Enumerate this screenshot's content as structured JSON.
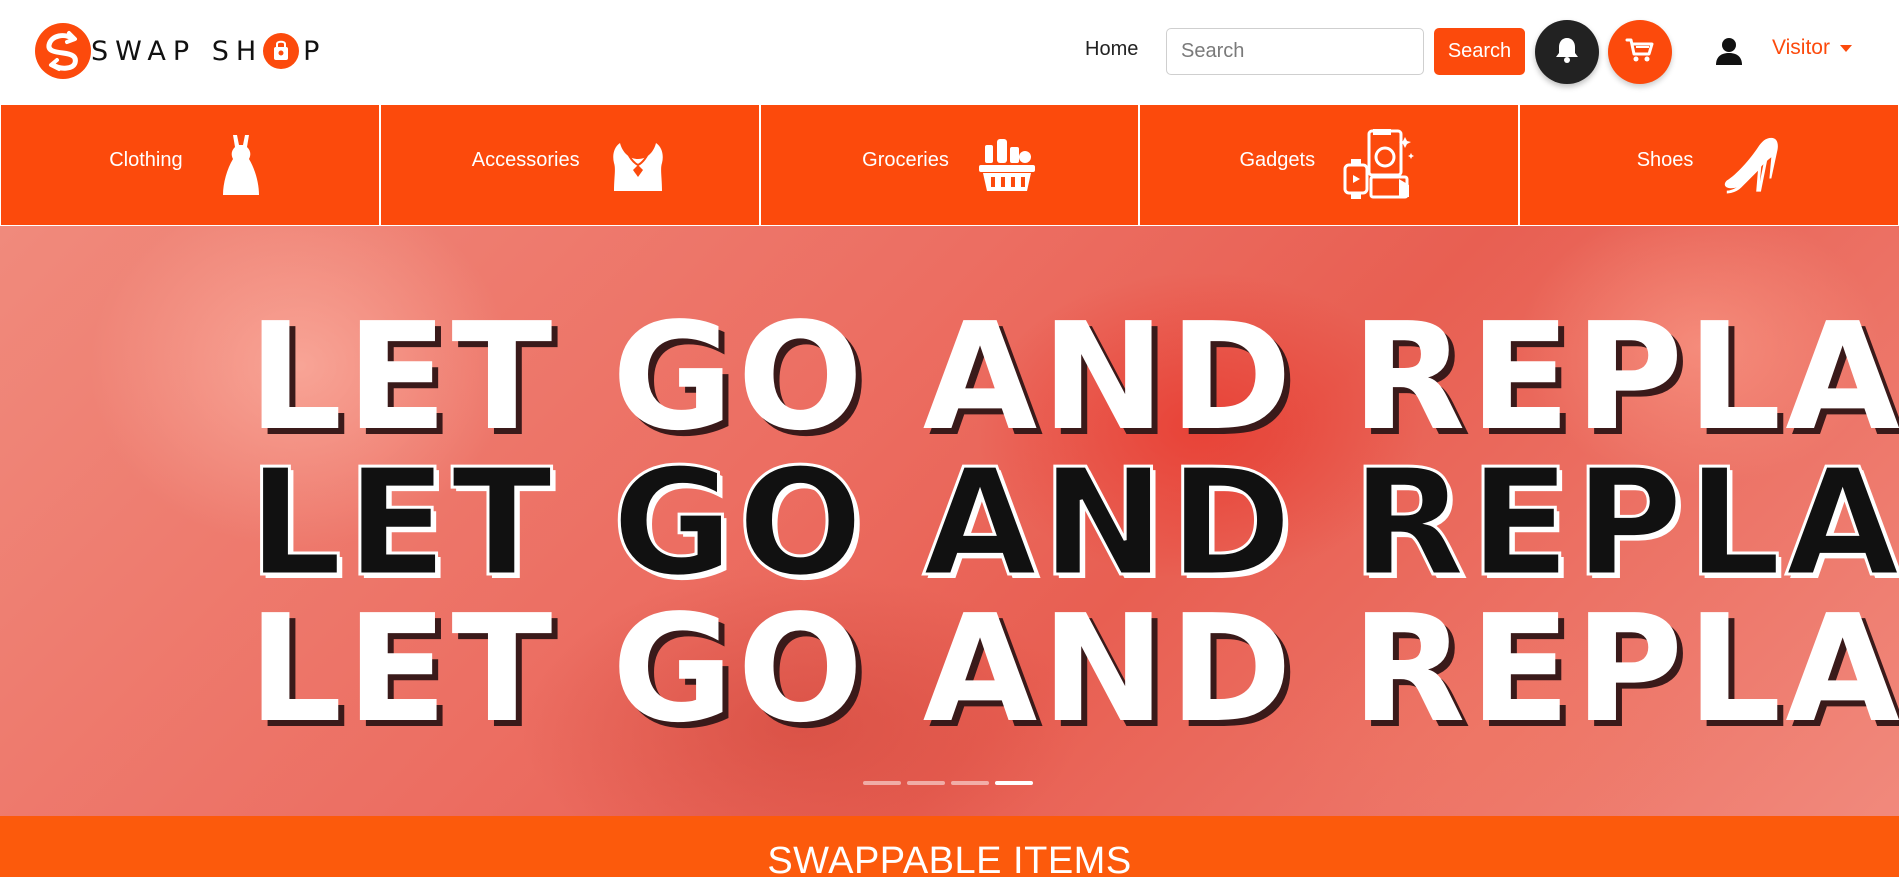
{
  "header": {
    "logo_text_1": "SWAP SH",
    "logo_text_2": "P",
    "nav_home": "Home",
    "search_placeholder": "Search",
    "search_button": "Search",
    "user_menu": "Visitor"
  },
  "icons": {
    "logo": "swap-arrows-icon",
    "logo_o": "shopping-bag-icon",
    "bell": "bell-icon",
    "cart": "cart-icon",
    "user": "user-icon",
    "caret": "caret-down-icon"
  },
  "categories": [
    {
      "label": "Clothing",
      "icon": "dress-icon"
    },
    {
      "label": "Accessories",
      "icon": "necklace-icon"
    },
    {
      "label": "Groceries",
      "icon": "grocery-basket-icon"
    },
    {
      "label": "Gadgets",
      "icon": "gadgets-icon"
    },
    {
      "label": "Shoes",
      "icon": "high-heels-icon"
    }
  ],
  "hero": {
    "lines": [
      "LET GO AND REPLACE",
      "LET GO AND REPLACE",
      "LET GO AND REPLACE"
    ],
    "slide_count": 4,
    "active_slide": 4
  },
  "section": {
    "title": "SWAPPABLE ITEMS"
  },
  "colors": {
    "brand": "#fc4a0c",
    "dark": "#222222",
    "white": "#ffffff"
  }
}
